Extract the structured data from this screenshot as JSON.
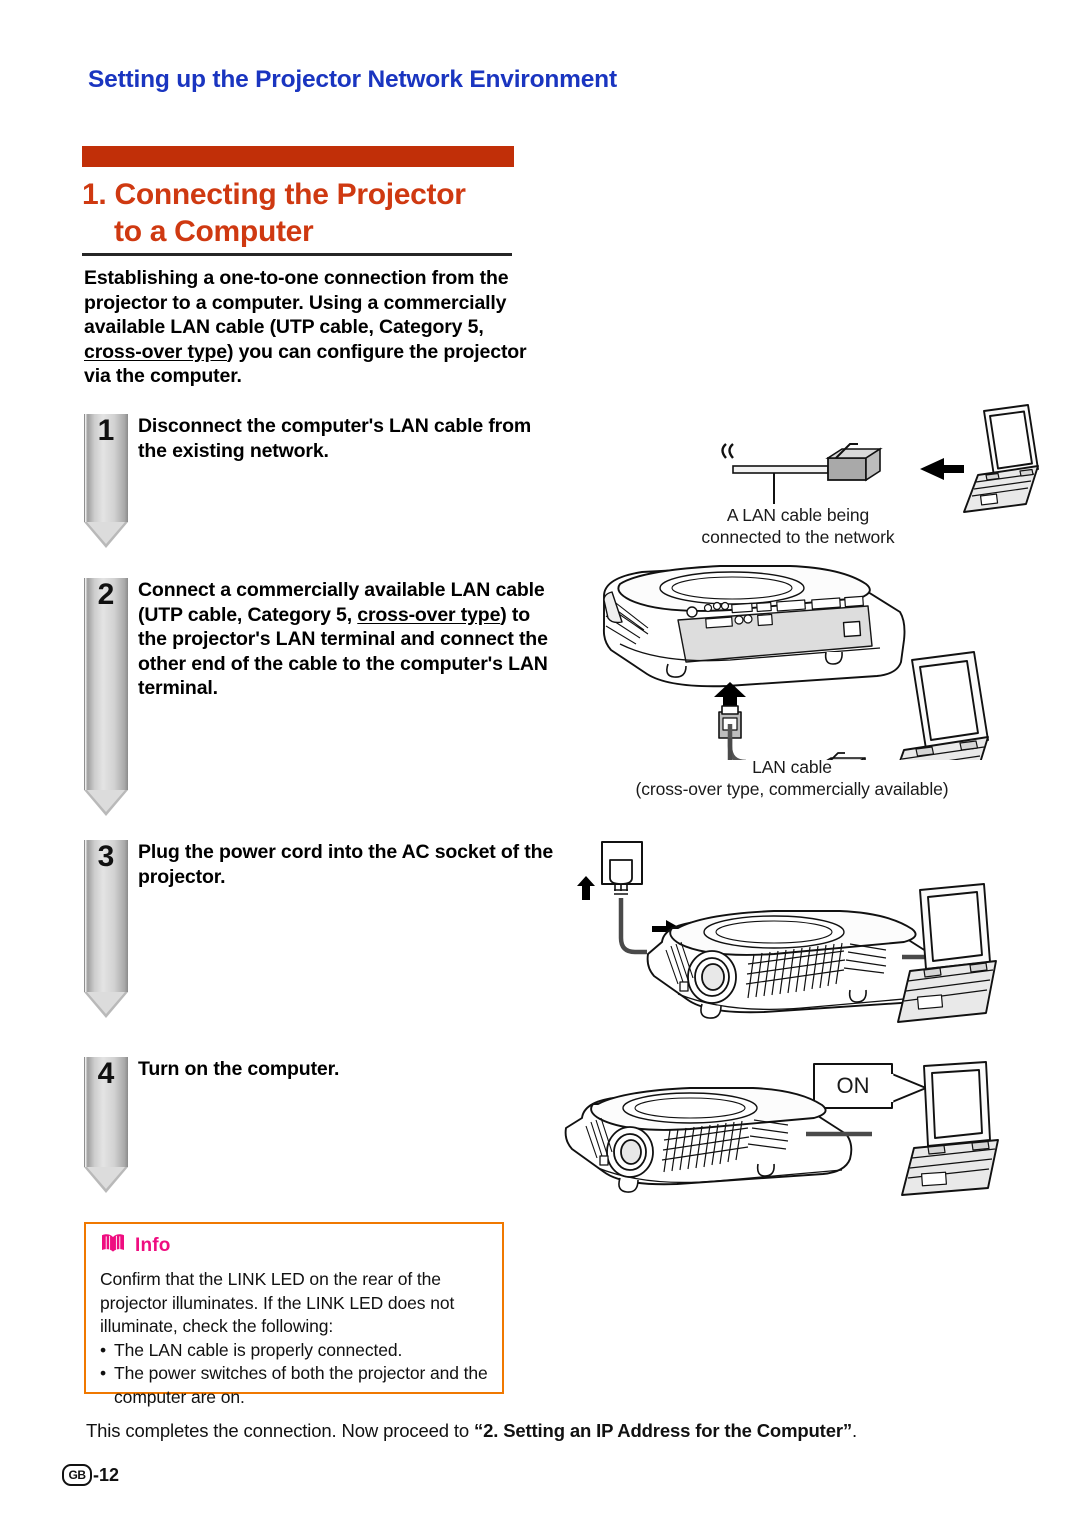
{
  "page": {
    "running_head": "Setting up the Projector Network Environment",
    "section_number_title_line1": "1. Connecting the Projector",
    "section_title_line2": "to a Computer",
    "intro": "Establishing a one-to-one connection from the projector to a computer. Using a commercially available LAN cable (UTP cable, Category 5, cross-over type) you can configure the projector via the computer.",
    "intro_parts": {
      "before": "Establishing a one-to-one connection from the projector to a computer. Using a commercially available LAN cable (UTP cable, Category 5, ",
      "underlined": "cross-over type",
      "after": ") you can configure the projector via the computer."
    },
    "closing_before": "This completes the connection. Now proceed to ",
    "closing_quoted": "“2. Setting an IP Address for the Computer”",
    "closing_after": ".",
    "folio_locale": "GB",
    "folio_number": "-12"
  },
  "steps": [
    {
      "number": "1",
      "text": "Disconnect the computer's LAN cable from the existing network."
    },
    {
      "number": "2",
      "text_parts": {
        "before": "Connect a commercially available LAN cable (UTP cable, Category 5, ",
        "underlined": "cross-over type",
        "after": ") to the projector's LAN terminal and connect the other end of the cable to the computer's LAN terminal."
      },
      "text": "Connect a commercially available LAN cable (UTP cable, Category 5, cross-over type) to the projector's LAN terminal and connect the other end of the cable to the computer's LAN terminal."
    },
    {
      "number": "3",
      "text": "Plug the power cord into the AC socket of the projector."
    },
    {
      "number": "4",
      "text": "Turn on the computer."
    }
  ],
  "figures": {
    "step1": {
      "caption_line1": "A LAN cable being",
      "caption_line2": "connected to the network"
    },
    "step2": {
      "caption_line1": "LAN cable",
      "caption_line2": "(cross-over type, commercially available)"
    },
    "step3": {
      "caption_line1": "",
      "caption_line2": ""
    },
    "step4": {
      "callout_label": "ON"
    }
  },
  "info": {
    "label": "Info",
    "line1": "Confirm that the LINK LED on the rear of the",
    "line2": "projector illuminates. If the LINK LED does not",
    "line3": "illuminate, check the following:",
    "bullet_symbol": "•",
    "bullets": [
      "The LAN cable is properly connected.",
      "The power switches of both the projector and the computer are on."
    ]
  },
  "colors": {
    "running_head_blue": "#1a35c0",
    "title_red": "#cf3911",
    "title_bar_red": "#c12f08",
    "info_border_orange": "#f07800",
    "info_label_magenta": "#ef0d80",
    "arrow_gray": "#cdcdcd"
  }
}
